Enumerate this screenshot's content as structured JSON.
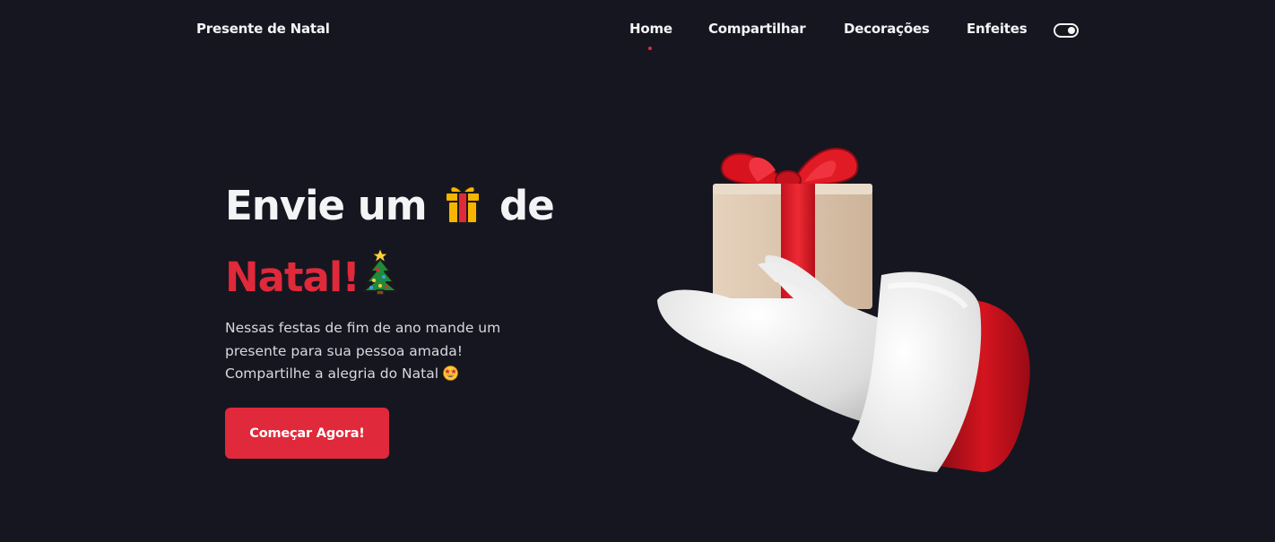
{
  "header": {
    "logo": "Presente de Natal",
    "nav": [
      {
        "label": "Home",
        "active": true
      },
      {
        "label": "Compartilhar",
        "active": false
      },
      {
        "label": "Decorações",
        "active": false
      },
      {
        "label": "Enfeites",
        "active": false
      }
    ],
    "theme_toggle_icon": "toggle-switch-icon"
  },
  "hero": {
    "title_line1_start": "Envie um",
    "title_emoji_1": "gift-icon",
    "title_line1_end": "de",
    "title_line2": "Natal!",
    "title_emoji_2": "christmas-tree-icon",
    "description_line1": "Nessas festas de fim de ano mande um",
    "description_line2": "presente para sua pessoa amada!",
    "description_line3": "Compartilhe a alegria do Natal",
    "description_emoji": "star-struck-icon",
    "cta_label": "Começar Agora!"
  },
  "illustration": {
    "icon": "santa-glove-holding-gift-icon"
  },
  "colors": {
    "background": "#161620",
    "accent": "#e0293a",
    "text": "#f4f4f6"
  }
}
